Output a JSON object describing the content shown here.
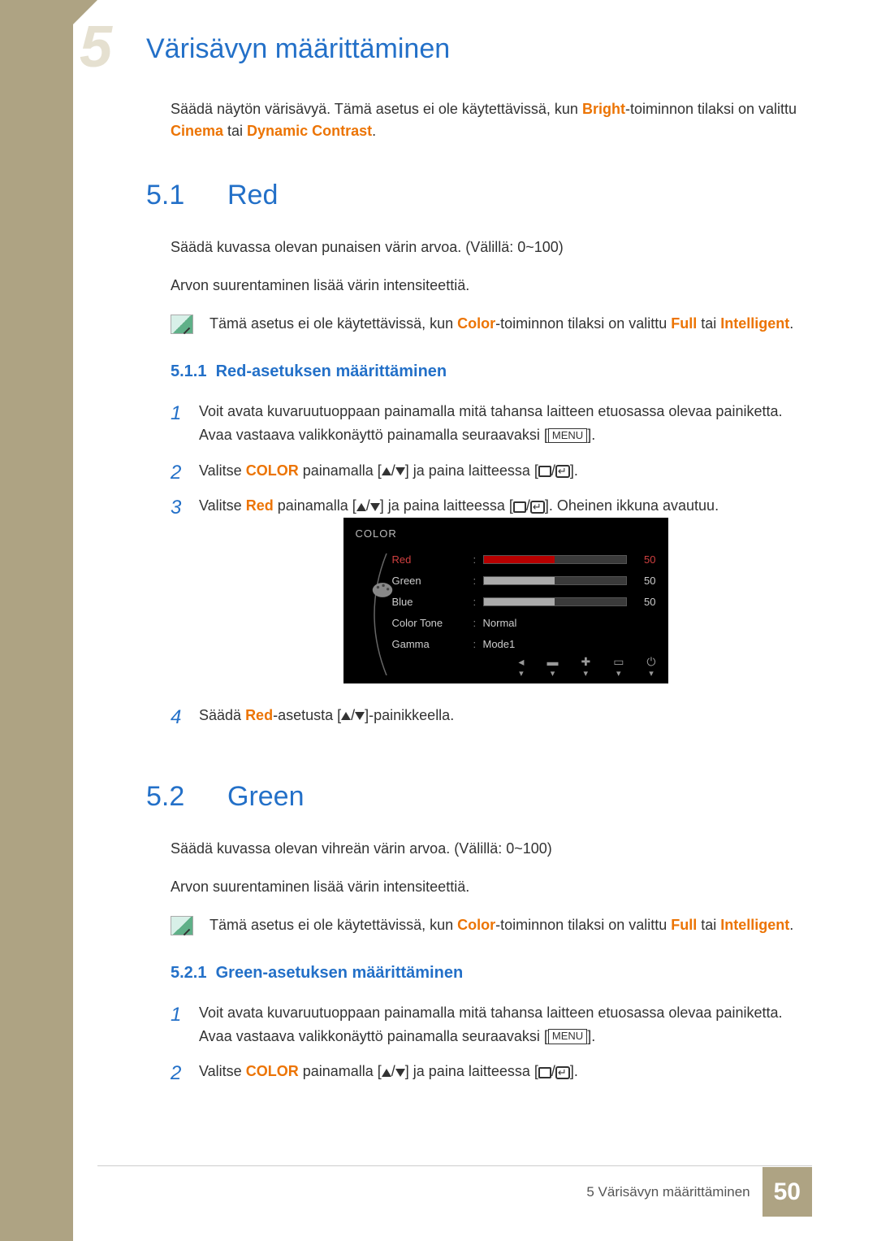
{
  "chapter_num_bg": "5",
  "main_title": "Värisävyn määrittäminen",
  "intro": {
    "t1": "Säädä näytön värisävyä. Tämä asetus ei ole käytettävissä, kun ",
    "bright": "Bright",
    "t2": "-toiminnon tilaksi on valittu ",
    "cinema": "Cinema",
    "or": " tai ",
    "dyn": "Dynamic Contrast",
    "end": "."
  },
  "s51": {
    "num": "5.1",
    "title": "Red"
  },
  "s51_p1": "Säädä kuvassa olevan punaisen värin arvoa. (Välillä: 0~100)",
  "s51_p2": "Arvon suurentaminen lisää värin intensiteettiä.",
  "note1": {
    "t1": "Tämä asetus ei ole käytettävissä, kun ",
    "color": "Color",
    "t2": "-toiminnon tilaksi on valittu ",
    "full": "Full",
    "or": " tai ",
    "intel": "Intelligent",
    "end": "."
  },
  "s511": {
    "num": "5.1.1",
    "title": "Red-asetuksen määrittäminen"
  },
  "steps1": {
    "s1a": "Voit avata kuvaruutuoppaan painamalla mitä tahansa laitteen etuosassa olevaa painiketta. Avaa vastaava valikkonäyttö painamalla seuraavaksi [",
    "menu": "MENU",
    "s1b": "].",
    "s2a": "Valitse ",
    "s2color": "COLOR",
    "s2b": " painamalla [",
    "s2c": "] ja paina laitteessa [",
    "s2d": "].",
    "s3a": "Valitse ",
    "s3red": "Red",
    "s3b": " painamalla [",
    "s3c": "] ja paina laitteessa [",
    "s3d": "]. Oheinen ikkuna avautuu.",
    "s4a": "Säädä ",
    "s4red": "Red",
    "s4b": "-asetusta [",
    "s4c": "]-painikkeella."
  },
  "osd": {
    "title": "COLOR",
    "red": "Red",
    "green": "Green",
    "blue": "Blue",
    "tone": "Color Tone",
    "gamma": "Gamma",
    "v_red": "50",
    "v_green": "50",
    "v_blue": "50",
    "v_tone": "Normal",
    "v_gamma": "Mode1",
    "colon": ":"
  },
  "s52": {
    "num": "5.2",
    "title": "Green"
  },
  "s52_p1": "Säädä kuvassa olevan vihreän värin arvoa. (Välillä: 0~100)",
  "s52_p2": "Arvon suurentaminen lisää värin intensiteettiä.",
  "s521": {
    "num": "5.2.1",
    "title": "Green-asetuksen määrittäminen"
  },
  "footer": {
    "text": "5 Värisävyn määrittäminen",
    "num": "50"
  }
}
